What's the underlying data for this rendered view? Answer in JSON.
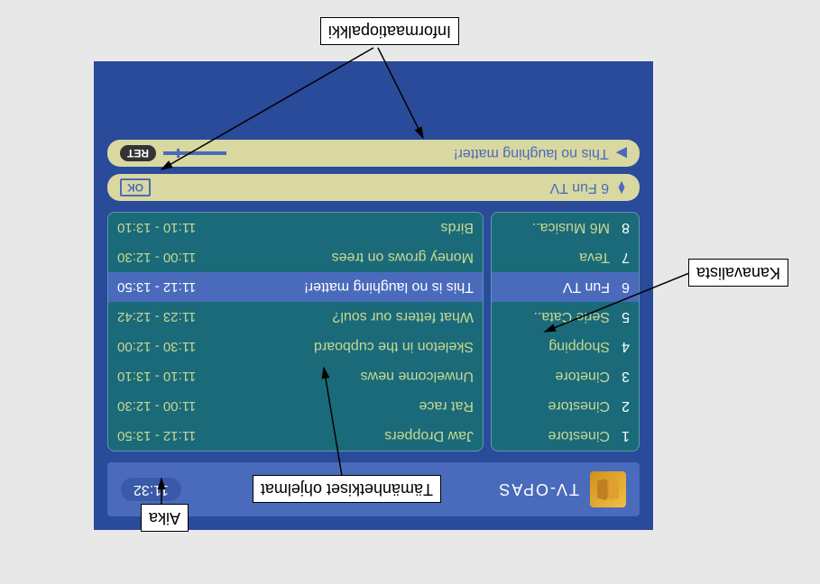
{
  "header": {
    "title": "TV-OPAS",
    "time": "11:32"
  },
  "channels": [
    {
      "num": "1",
      "name": "Cinestore"
    },
    {
      "num": "2",
      "name": "Cinestore"
    },
    {
      "num": "3",
      "name": "Cinetore"
    },
    {
      "num": "4",
      "name": "Shopping"
    },
    {
      "num": "5",
      "name": "Serie Cata.."
    },
    {
      "num": "6",
      "name": "Fun TV"
    },
    {
      "num": "7",
      "name": "Teva"
    },
    {
      "num": "8",
      "name": "M6 Musica.."
    }
  ],
  "programs": [
    {
      "name": "Jaw Droppers",
      "time": "11:12 - 13:50"
    },
    {
      "name": "Rat race",
      "time": "11:00 - 12:30"
    },
    {
      "name": "Unwelcome news",
      "time": "11:10 - 13:10"
    },
    {
      "name": "Skeleton in the cupboard",
      "time": "11:30 - 12:00"
    },
    {
      "name": "What fetters our soul?",
      "time": "11:23 - 12:42"
    },
    {
      "name": "This is no laughing matter!",
      "time": "11:12 - 13:50"
    },
    {
      "name": "Money grows on trees",
      "time": "11:00 - 12:30"
    },
    {
      "name": "Birds",
      "time": "11:10 - 13:10"
    }
  ],
  "selectedIndex": 5,
  "info1": {
    "text": "6 Fun TV",
    "button": "OK"
  },
  "info2": {
    "text": "This no laughing matter!",
    "button": "RET"
  },
  "callouts": {
    "kanavalista": "Kanavalista",
    "aika": "Aika",
    "ohjelmat": "Tämänhetkiset ohjelmat",
    "infopalkki": "Informaatiopalkki"
  }
}
